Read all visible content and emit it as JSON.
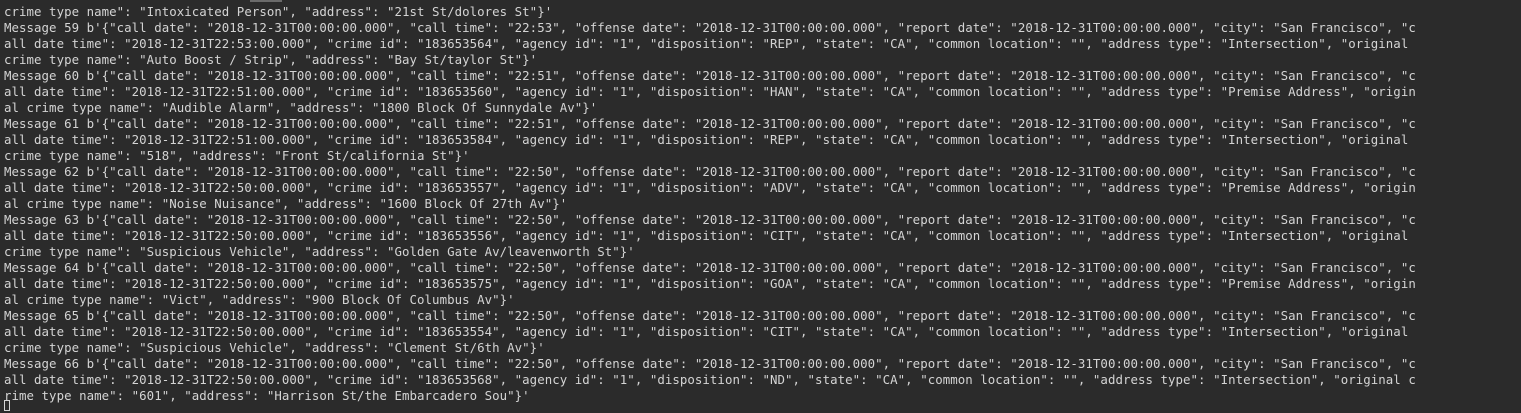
{
  "terminal": {
    "lines": [
      "crime type name\": \"Intoxicated Person\", \"address\": \"21st St/dolores St\"}'",
      "Message 59 b'{\"call date\": \"2018-12-31T00:00:00.000\", \"call time\": \"22:53\", \"offense date\": \"2018-12-31T00:00:00.000\", \"report date\": \"2018-12-31T00:00:00.000\", \"city\": \"San Francisco\", \"c",
      "all date time\": \"2018-12-31T22:53:00.000\", \"crime id\": \"183653564\", \"agency id\": \"1\", \"disposition\": \"REP\", \"state\": \"CA\", \"common location\": \"\", \"address type\": \"Intersection\", \"original",
      "crime type name\": \"Auto Boost / Strip\", \"address\": \"Bay St/taylor St\"}'",
      "Message 60 b'{\"call date\": \"2018-12-31T00:00:00.000\", \"call time\": \"22:51\", \"offense date\": \"2018-12-31T00:00:00.000\", \"report date\": \"2018-12-31T00:00:00.000\", \"city\": \"San Francisco\", \"c",
      "all date time\": \"2018-12-31T22:51:00.000\", \"crime id\": \"183653560\", \"agency id\": \"1\", \"disposition\": \"HAN\", \"state\": \"CA\", \"common location\": \"\", \"address type\": \"Premise Address\", \"origin",
      "al crime type name\": \"Audible Alarm\", \"address\": \"1800 Block Of Sunnydale Av\"}'",
      "Message 61 b'{\"call date\": \"2018-12-31T00:00:00.000\", \"call time\": \"22:51\", \"offense date\": \"2018-12-31T00:00:00.000\", \"report date\": \"2018-12-31T00:00:00.000\", \"city\": \"San Francisco\", \"c",
      "all date time\": \"2018-12-31T22:51:00.000\", \"crime id\": \"183653584\", \"agency id\": \"1\", \"disposition\": \"REP\", \"state\": \"CA\", \"common location\": \"\", \"address type\": \"Intersection\", \"original",
      "crime type name\": \"518\", \"address\": \"Front St/california St\"}'",
      "Message 62 b'{\"call date\": \"2018-12-31T00:00:00.000\", \"call time\": \"22:50\", \"offense date\": \"2018-12-31T00:00:00.000\", \"report date\": \"2018-12-31T00:00:00.000\", \"city\": \"San Francisco\", \"c",
      "all date time\": \"2018-12-31T22:50:00.000\", \"crime id\": \"183653557\", \"agency id\": \"1\", \"disposition\": \"ADV\", \"state\": \"CA\", \"common location\": \"\", \"address type\": \"Premise Address\", \"origin",
      "al crime type name\": \"Noise Nuisance\", \"address\": \"1600 Block Of 27th Av\"}'",
      "Message 63 b'{\"call date\": \"2018-12-31T00:00:00.000\", \"call time\": \"22:50\", \"offense date\": \"2018-12-31T00:00:00.000\", \"report date\": \"2018-12-31T00:00:00.000\", \"city\": \"San Francisco\", \"c",
      "all date time\": \"2018-12-31T22:50:00.000\", \"crime id\": \"183653556\", \"agency id\": \"1\", \"disposition\": \"CIT\", \"state\": \"CA\", \"common location\": \"\", \"address type\": \"Intersection\", \"original",
      "crime type name\": \"Suspicious Vehicle\", \"address\": \"Golden Gate Av/leavenworth St\"}'",
      "Message 64 b'{\"call date\": \"2018-12-31T00:00:00.000\", \"call time\": \"22:50\", \"offense date\": \"2018-12-31T00:00:00.000\", \"report date\": \"2018-12-31T00:00:00.000\", \"city\": \"San Francisco\", \"c",
      "all date time\": \"2018-12-31T22:50:00.000\", \"crime id\": \"183653575\", \"agency id\": \"1\", \"disposition\": \"GOA\", \"state\": \"CA\", \"common location\": \"\", \"address type\": \"Premise Address\", \"origin",
      "al crime type name\": \"Vict\", \"address\": \"900 Block Of Columbus Av\"}'",
      "Message 65 b'{\"call date\": \"2018-12-31T00:00:00.000\", \"call time\": \"22:50\", \"offense date\": \"2018-12-31T00:00:00.000\", \"report date\": \"2018-12-31T00:00:00.000\", \"city\": \"San Francisco\", \"c",
      "all date time\": \"2018-12-31T22:50:00.000\", \"crime id\": \"183653554\", \"agency id\": \"1\", \"disposition\": \"CIT\", \"state\": \"CA\", \"common location\": \"\", \"address type\": \"Intersection\", \"original",
      "crime type name\": \"Suspicious Vehicle\", \"address\": \"Clement St/6th Av\"}'",
      "Message 66 b'{\"call date\": \"2018-12-31T00:00:00.000\", \"call time\": \"22:50\", \"offense date\": \"2018-12-31T00:00:00.000\", \"report date\": \"2018-12-31T00:00:00.000\", \"city\": \"San Francisco\", \"c",
      "all date time\": \"2018-12-31T22:50:00.000\", \"crime id\": \"183653568\", \"agency id\": \"1\", \"disposition\": \"ND\", \"state\": \"CA\", \"common location\": \"\", \"address type\": \"Intersection\", \"original c",
      "rime type name\": \"601\", \"address\": \"Harrison St/the Embarcadero Sou\"}'"
    ]
  },
  "colors": {
    "background": "#2b2b2b",
    "text": "#d4d4d4"
  }
}
